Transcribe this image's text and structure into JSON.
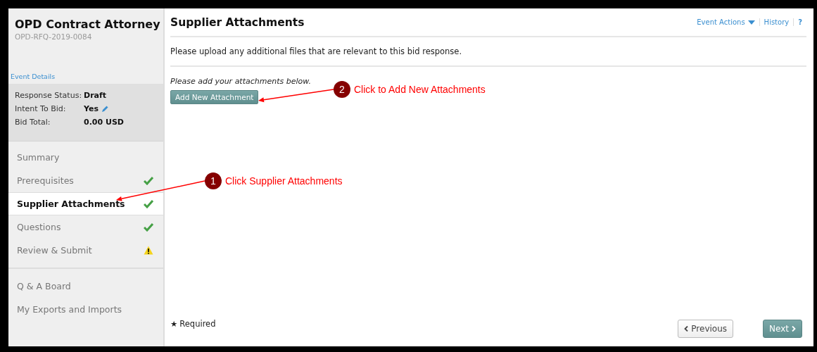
{
  "sidebar": {
    "title": "OPD Contract Attorney",
    "subtitle": "OPD-RFQ-2019-0084",
    "event_details": "Event Details",
    "summary": [
      {
        "label": "Response Status:",
        "value": "Draft",
        "editable": false
      },
      {
        "label": "Intent To Bid:",
        "value": "Yes",
        "editable": true
      },
      {
        "label": "Bid Total:",
        "value": "0.00 USD",
        "editable": false
      }
    ],
    "nav_items": [
      {
        "label": "Summary",
        "selected": false,
        "kind": "plain"
      },
      {
        "label": "Prerequisites",
        "selected": false,
        "kind": "complete"
      },
      {
        "label": "Supplier Attachments",
        "selected": true,
        "kind": "complete"
      },
      {
        "label": "Questions",
        "selected": false,
        "kind": "complete"
      },
      {
        "label": "Review & Submit",
        "selected": false,
        "kind": "warning"
      }
    ],
    "links": [
      "Q & A Board",
      "My Exports and Imports"
    ]
  },
  "main": {
    "title": "Supplier Attachments",
    "actions": [
      {
        "label": "Event Actions",
        "kind": "menu"
      },
      {
        "label": "History",
        "kind": "link"
      },
      {
        "label": "?",
        "kind": "help"
      }
    ],
    "description": "Please upload any additional files that are relevant to this bid response.",
    "instruction": "Please add your attachments below.",
    "add_button": "Add New Attachment",
    "required_mark": "★",
    "required_note": "Required",
    "previous": "Previous",
    "next": "Next"
  },
  "callouts": [
    {
      "number": "1",
      "text": "Click Supplier Attachments"
    },
    {
      "number": "2",
      "text": "Click to Add New Attachments"
    }
  ]
}
